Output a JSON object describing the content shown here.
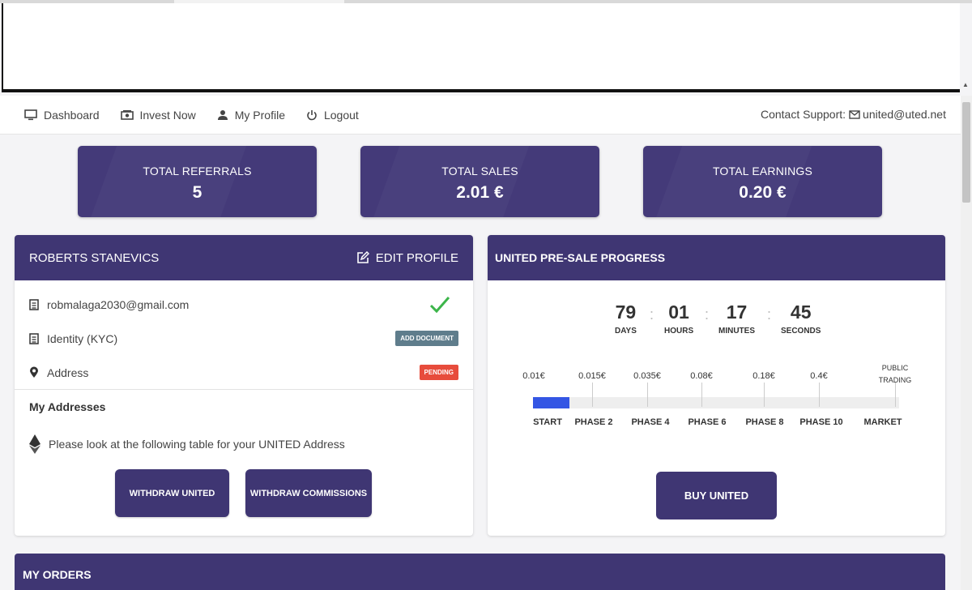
{
  "nav": {
    "items": [
      {
        "label": "Dashboard",
        "icon": "monitor-icon"
      },
      {
        "label": "Invest Now",
        "icon": "money-icon"
      },
      {
        "label": "My Profile",
        "icon": "user-icon"
      },
      {
        "label": "Logout",
        "icon": "power-icon"
      }
    ],
    "contact_label": "Contact Support:",
    "contact_email": "united@uted.net"
  },
  "stats": [
    {
      "label": "TOTAL REFERRALS",
      "value": "5"
    },
    {
      "label": "TOTAL SALES",
      "value": "2.01 €"
    },
    {
      "label": "TOTAL EARNINGS",
      "value": "0.20 €"
    }
  ],
  "profile": {
    "name": "ROBERTS STANEVICS",
    "edit_label": "EDIT PROFILE",
    "email": "robmalaga2030@gmail.com",
    "kyc_label": "Identity (KYC)",
    "kyc_badge": "ADD DOCUMENT",
    "address_label": "Address",
    "address_badge": "PENDING",
    "addresses_title": "My Addresses",
    "addresses_note": "Please look at the following table for your UNITED Address",
    "withdraw_united": "WITHDRAW UNITED",
    "withdraw_commissions": "WITHDRAW COMMISSIONS"
  },
  "presale": {
    "title": "UNITED PRE-SALE PROGRESS",
    "timer": [
      {
        "value": "79",
        "unit": "DAYS"
      },
      {
        "value": "01",
        "unit": "HOURS"
      },
      {
        "value": "17",
        "unit": "MINUTES"
      },
      {
        "value": "45",
        "unit": "SECONDS"
      }
    ],
    "prices": [
      "0.01€",
      "0.015€",
      "0.035€",
      "0.08€",
      "0.18€",
      "0.4€"
    ],
    "final_price_line1": "PUBLIC",
    "final_price_line2": "TRADING",
    "phases": [
      "START",
      "PHASE 2",
      "PHASE 4",
      "PHASE 6",
      "PHASE 8",
      "PHASE 10",
      "MARKET"
    ],
    "progress_fraction": 0.1,
    "buy_label": "BUY UNITED"
  },
  "orders": {
    "title": "MY ORDERS"
  },
  "colors": {
    "primary": "#3f3673",
    "progress": "#3456e4",
    "success": "#3cb54a",
    "pending": "#e74c3c",
    "doc": "#5f7d8c"
  }
}
